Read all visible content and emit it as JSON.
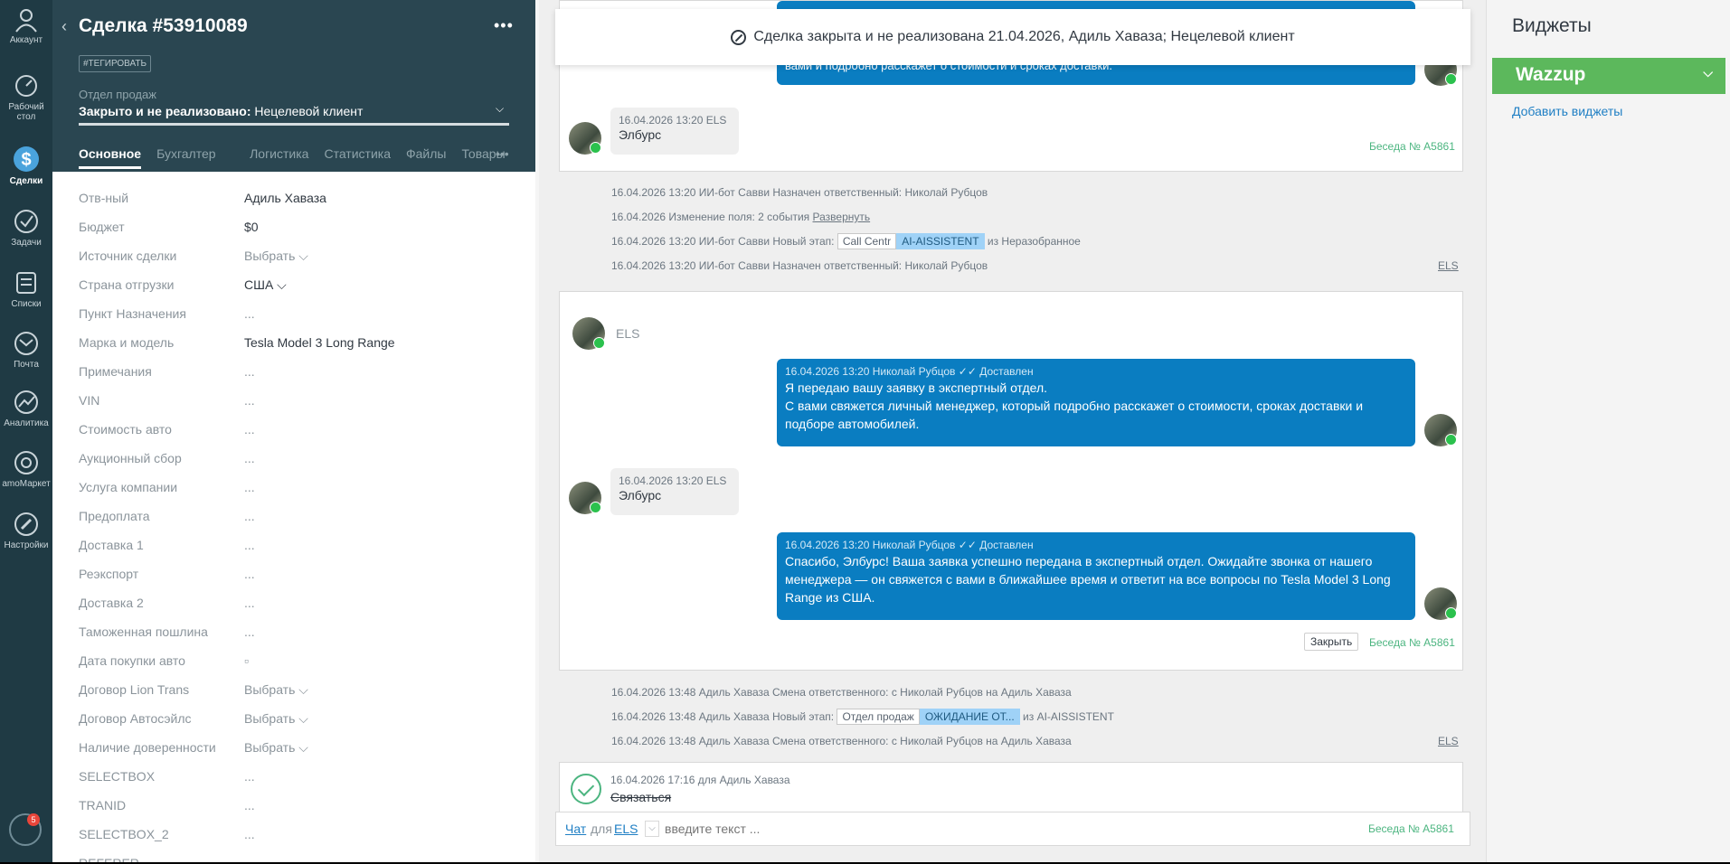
{
  "nav": {
    "items": [
      {
        "label": "Аккаунт",
        "icon": "account-icon"
      },
      {
        "label": "Рабочий стол",
        "icon": "dashboard-icon"
      },
      {
        "label": "Сделки",
        "icon": "deals-icon"
      },
      {
        "label": "Задачи",
        "icon": "tasks-icon"
      },
      {
        "label": "Списки",
        "icon": "lists-icon"
      },
      {
        "label": "Почта",
        "icon": "mail-icon"
      },
      {
        "label": "Аналитика",
        "icon": "analytics-icon"
      },
      {
        "label": "amoМаркет",
        "icon": "market-icon"
      },
      {
        "label": "Настройки",
        "icon": "settings-icon"
      }
    ],
    "notifications_count": "5"
  },
  "deal": {
    "title": "Сделка #53910089",
    "tag_button": "#ТЕГИРОВАТЬ",
    "pipeline": "Отдел продаж",
    "status_bold": "Закрыто и не реализовано:",
    "status_reason": "Нецелевой клиент",
    "tabs": [
      "Основное",
      "Бухгалтер",
      "Логистика",
      "Статистика",
      "Файлы",
      "Товары"
    ],
    "fields": [
      {
        "label": "Отв-ный",
        "value": "Адиль Хаваза"
      },
      {
        "label": "Бюджет",
        "value": "$0"
      },
      {
        "label": "Источник сделки",
        "value": "Выбрать ⌵"
      },
      {
        "label": "Страна отгрузки",
        "value": "США ⌵"
      },
      {
        "label": "Пункт Назначения",
        "value": "..."
      },
      {
        "label": "Марка и модель",
        "value": "Tesla Model 3 Long Range"
      },
      {
        "label": "Примечания",
        "value": "..."
      },
      {
        "label": "VIN",
        "value": "..."
      },
      {
        "label": "Стоимость авто",
        "value": "..."
      },
      {
        "label": "Аукционный сбор",
        "value": "..."
      },
      {
        "label": "Услуга компании",
        "value": "..."
      },
      {
        "label": "Предоплата",
        "value": "..."
      },
      {
        "label": "Доставка 1",
        "value": "..."
      },
      {
        "label": "Реэкспорт",
        "value": "..."
      },
      {
        "label": "Доставка 2",
        "value": "..."
      },
      {
        "label": "Таможенная пошлина",
        "value": "..."
      },
      {
        "label": "Дата покупки авто",
        "value": "▫"
      },
      {
        "label": "Договор Lion Trans",
        "value": "Выбрать ⌵"
      },
      {
        "label": "Договор Автосэйлс",
        "value": "Выбрать ⌵"
      },
      {
        "label": "Наличие довереннoсти",
        "value": "Выбрать ⌵"
      },
      {
        "label": "SELECTBOX",
        "value": "..."
      },
      {
        "label": "TRANID",
        "value": "..."
      },
      {
        "label": "SELECTBOX_2",
        "value": "..."
      },
      {
        "label": "REFERER",
        "value": "..."
      }
    ]
  },
  "feed": {
    "banner": "Сделка закрыта и не реализована 21.04.2026, Адиль Хаваза; Нецелевой клиент",
    "top_bubble_tail": "вами и подробно расскажет о стоимости и сроках доставки.",
    "msg_in_1": {
      "meta": "16.04.2026 13:20 ELS",
      "text": "Элбурс"
    },
    "conversation_link": "Беседа № A5861",
    "events_1": [
      "16.04.2026 13:20 ИИ-бот Савви Назначен ответственный: Николай Рубцов",
      "16.04.2026 Изменение поля: 2 события",
      "16.04.2026 13:20 ИИ-бот Савви Новый этап:",
      "16.04.2026 13:20 ИИ-бот Савви Назначен ответственный: Николай Рубцов"
    ],
    "expand_link": "Развернуть",
    "stage_1": {
      "from_chip": "Call Centr",
      "to_chip": "AI-AISSISTENT",
      "suffix": "из Неразобранное"
    },
    "els_link": "ELS",
    "chat_header": "ELS",
    "msg_out_1": {
      "meta": "16.04.2026 13:20 Николай Рубцов ✓✓ Доставлен",
      "line1": "Я передаю вашу заявку в экспертный отдел.",
      "line2": "С вами свяжется личный менеджер, который подробно расскажет о стоимости, сроках доставки и подборе автомобилей."
    },
    "msg_in_2": {
      "meta": "16.04.2026 13:20 ELS",
      "text": "Элбурс"
    },
    "msg_out_2": {
      "meta": "16.04.2026 13:20 Николай Рубцов ✓✓ Доставлен",
      "text": "Спасибо, Элбурс! Ваша заявка успешно передана в экспертный отдел. Ожидайте звонка от нашего менеджера — он свяжется с вами в ближайшее время и ответит на все вопросы по Tesla Model 3 Long Range из США."
    },
    "close_button": "Закрыть",
    "events_2": [
      "16.04.2026 13:48 Адиль Хаваза Смена ответственного: с Николай Рубцов на Адиль Хаваза",
      "16.04.2026 13:48 Адиль Хаваза Новый этап:",
      "16.04.2026 13:48 Адиль Хаваза Смена ответственного: с Николай Рубцов на Адиль Хаваза"
    ],
    "stage_2": {
      "from_chip": "Отдел продаж",
      "to_chip": "ОЖИДАНИЕ ОТ...",
      "suffix": "из AI-AISSISTENT"
    },
    "task": {
      "meta": "16.04.2026 17:16  для Адиль Хаваза",
      "text": "Связаться"
    },
    "chat_input": {
      "chat_link": "Чат",
      "for_word": "для",
      "target": "ELS",
      "placeholder": "введите текст ..."
    }
  },
  "widgets": {
    "title": "Виджеты",
    "wazzup": "Wazzup",
    "add_link": "Добавить виджеты"
  }
}
